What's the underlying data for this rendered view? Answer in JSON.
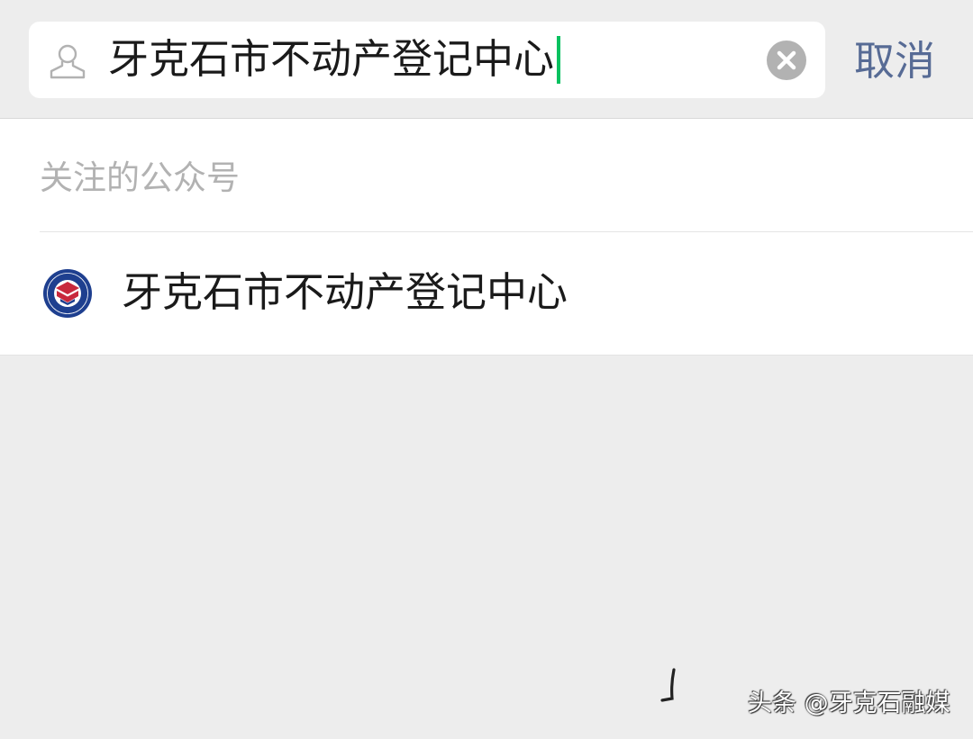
{
  "search": {
    "type_icon": "person-icon",
    "query": "牙克石市不动产登记中心",
    "clear_icon": "clear-x-icon",
    "cancel_label": "取消"
  },
  "results": {
    "section_title": "关注的公众号",
    "items": [
      {
        "avatar_icon": "real-estate-registration-logo",
        "name": "牙克石市不动产登记中心"
      }
    ]
  },
  "watermark": {
    "text": "头条 @牙克石融媒"
  },
  "colors": {
    "background": "#ededed",
    "accent_cursor": "#07c160",
    "link_blue": "#576b95",
    "hint_gray": "#b2b2b2",
    "logo_blue": "#1e3f8f",
    "logo_red": "#c8283c"
  }
}
